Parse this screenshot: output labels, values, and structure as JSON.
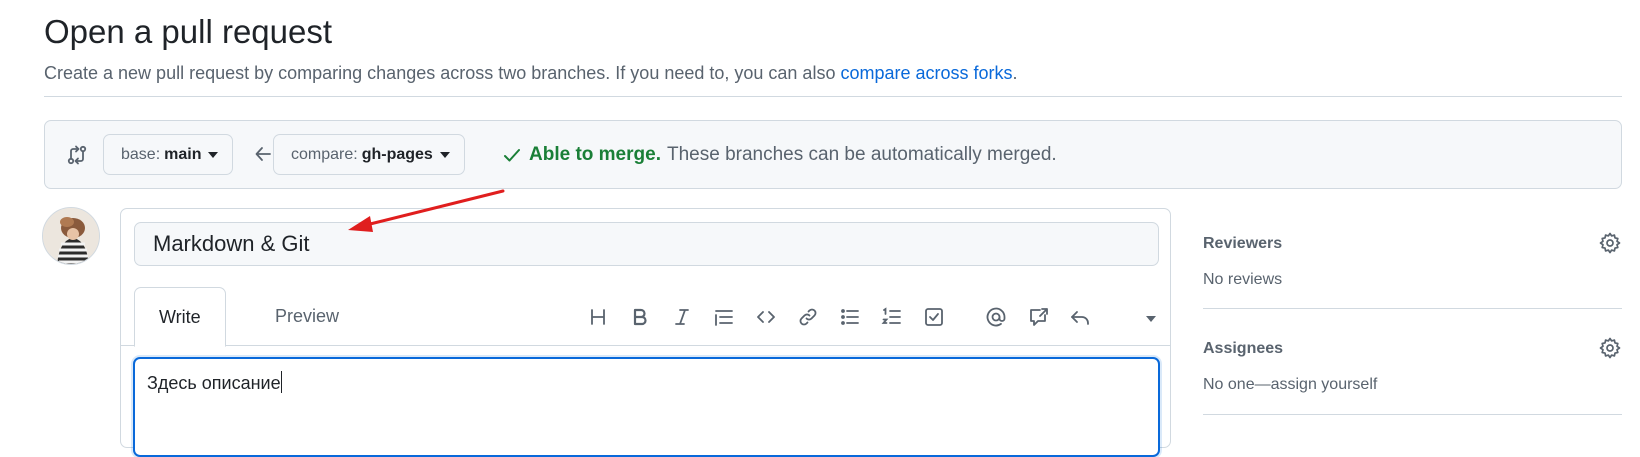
{
  "page": {
    "title": "Open a pull request",
    "subtitle_prefix": "Create a new pull request by comparing changes across two branches. If you need to, you can also ",
    "subtitle_link": "compare across forks",
    "subtitle_suffix": "."
  },
  "compare": {
    "base_label": "base:",
    "base_branch": "main",
    "compare_label": "compare:",
    "compare_branch": "gh-pages",
    "merge_ok": "Able to merge.",
    "merge_text": "These branches can be automatically merged."
  },
  "editor": {
    "title_value": "Markdown & Git",
    "tabs": [
      {
        "label": "Write",
        "active": true
      },
      {
        "label": "Preview",
        "active": false
      }
    ],
    "toolbar": [
      "heading-icon",
      "bold-icon",
      "italic-icon",
      "quote-icon",
      "code-icon",
      "link-icon",
      "unordered-list-icon",
      "ordered-list-icon",
      "task-list-icon",
      "mention-icon",
      "reference-icon",
      "saved-replies-icon"
    ],
    "body_value": "Здесь описание"
  },
  "sidebar": {
    "reviewers": {
      "title": "Reviewers",
      "value": "No reviews"
    },
    "assignees": {
      "title": "Assignees",
      "value": "No one—assign yourself"
    }
  },
  "colors": {
    "accent": "#0969da",
    "success": "#1a7f37",
    "annotation_arrow": "#e01e1e",
    "border": "#d1d9e0"
  }
}
